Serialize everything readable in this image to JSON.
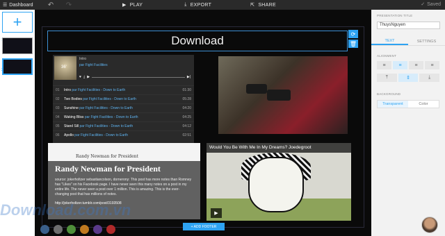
{
  "topbar": {
    "back_label": "Dashboard",
    "play_label": "PLAY",
    "export_label": "EXPORT",
    "share_label": "SHARE",
    "saved_label": "Saved"
  },
  "slides": {
    "thumb_numbers": [
      "1",
      "2"
    ]
  },
  "slide": {
    "title": "Download",
    "add_footer_label": "+ ADD FOOTER"
  },
  "player": {
    "album": "Intro",
    "artist_line": "par Fight Facilities",
    "time_badge": "36'",
    "tracks": [
      {
        "n": "01",
        "name": "Intro",
        "by": "par Fight Facilities - Down to Earth",
        "dur": "01:30"
      },
      {
        "n": "02",
        "name": "Two Bodies",
        "by": "par Fight Facilities - Down to Earth",
        "dur": "05:28"
      },
      {
        "n": "03",
        "name": "Sunshine",
        "by": "par Fight Facilities - Down to Earth",
        "dur": "04:20"
      },
      {
        "n": "04",
        "name": "Waking Bliss",
        "by": "par Fight Facilities - Down to Earth",
        "dur": "04:25"
      },
      {
        "n": "05",
        "name": "Stand Sill",
        "by": "par Fight Facilities - Down to Earth",
        "dur": "04:12"
      },
      {
        "n": "06",
        "name": "Apollo",
        "by": "par Fight Facilities - Down to Earth",
        "dur": "02:51"
      }
    ]
  },
  "article": {
    "mini_title": "Randy Newman for President",
    "title": "Randy Newman for President",
    "body": "source: jokerholtzer sebastiancolson, dornerony: This post has more notes than Romney has \"Likes\" on his Facebook page. I have never seen this many notes on a post in my entire life. The never seen a post over 1 million. This is amazing. This is the ever-changing post that has millions of notes.",
    "link": "http://jokerholtzer.tumblr.com/post/3193508"
  },
  "comic": {
    "title": "Would You Be With Me In My Dreams? Joedegroot"
  },
  "panel": {
    "presentation_title_label": "PRESENTATION TITLE",
    "presentation_title_value": "ThuysNguyen",
    "tab_text": "TEXT",
    "tab_settings": "SETTINGS",
    "alignment_label": "ALIGNMENT",
    "background_label": "BACKGROUND",
    "bg_transparent": "Transparent",
    "bg_color": "Color"
  },
  "watermark": "Download.com.vn",
  "colors": {
    "accent": "#2ea3f2",
    "swatches": [
      "#3a5f8a",
      "#6e6e6e",
      "#4f8f3a",
      "#c07a20",
      "#5a3a8a",
      "#b02a2a"
    ]
  },
  "icons": [
    "menu-icon",
    "undo-icon",
    "redo-icon",
    "play-icon",
    "download-icon",
    "share-icon",
    "check-icon",
    "plus-icon",
    "rotate-icon",
    "trash-icon"
  ]
}
